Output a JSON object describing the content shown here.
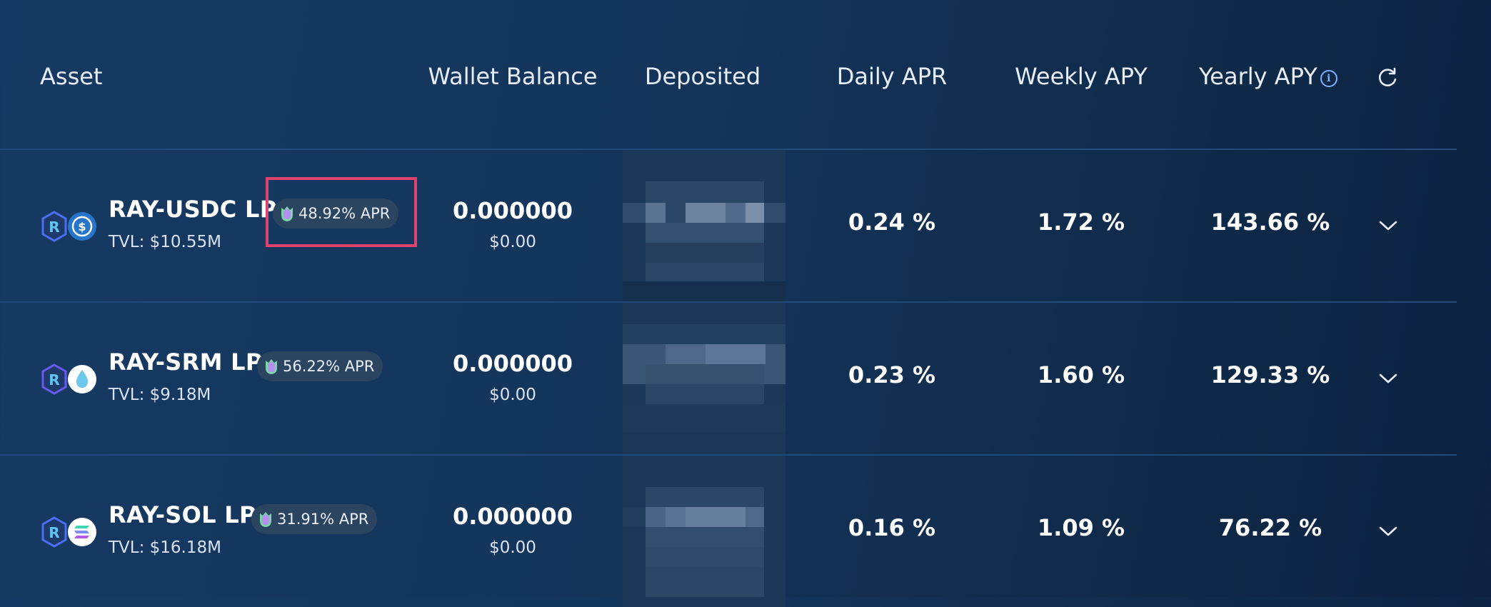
{
  "header": {
    "asset": "Asset",
    "wallet_balance": "Wallet Balance",
    "deposited": "Deposited",
    "daily_apr": "Daily APR",
    "weekly_apy": "Weekly APY",
    "yearly_apy": "Yearly APY",
    "info_glyph": "i"
  },
  "colors": {
    "accent_border": "#e0426e",
    "row_divider": "#234a7a",
    "badge_bg": "#2b4560"
  },
  "rows": [
    {
      "name": "RAY-USDC LP",
      "apr_badge": "48.92% APR",
      "tvl": "TVL: $10.55M",
      "wallet_balance": "0.000000",
      "wallet_usd": "$0.00",
      "daily_apr": "0.24 %",
      "weekly_apy": "1.72 %",
      "yearly_apy": "143.66 %",
      "token_icon": "usdc-icon"
    },
    {
      "name": "RAY-SRM LP",
      "apr_badge": "56.22% APR",
      "tvl": "TVL: $9.18M",
      "wallet_balance": "0.000000",
      "wallet_usd": "$0.00",
      "daily_apr": "0.23 %",
      "weekly_apy": "1.60 %",
      "yearly_apy": "129.33 %",
      "token_icon": "srm-icon"
    },
    {
      "name": "RAY-SOL LP",
      "apr_badge": "31.91% APR",
      "tvl": "TVL: $16.18M",
      "wallet_balance": "0.000000",
      "wallet_usd": "$0.00",
      "daily_apr": "0.16 %",
      "weekly_apy": "1.09 %",
      "yearly_apy": "76.22 %",
      "token_icon": "sol-icon"
    }
  ]
}
